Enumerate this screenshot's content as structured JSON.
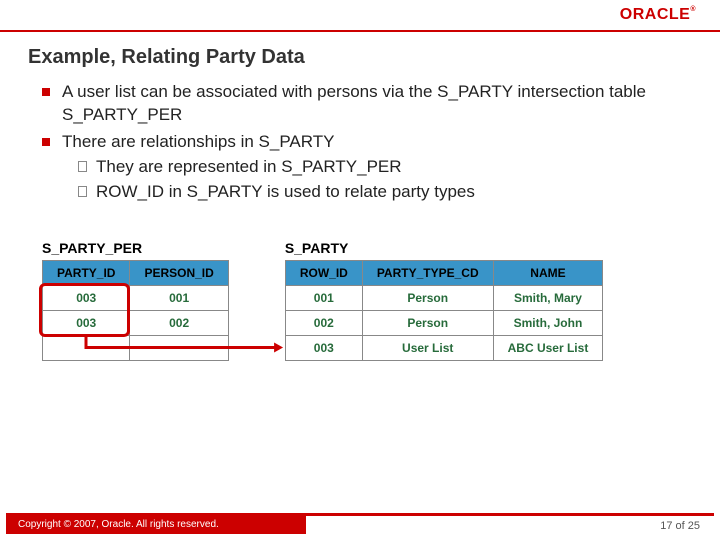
{
  "logo_text": "ORACLE",
  "title": "Example, Relating Party Data",
  "bullets": [
    {
      "text": "A user list can be associated with persons via the S_PARTY intersection table S_PARTY_PER",
      "sub": []
    },
    {
      "text": "There are relationships in S_PARTY",
      "sub": [
        "They are represented in S_PARTY_PER",
        "ROW_ID in S_PARTY is used to relate party types"
      ]
    }
  ],
  "table1": {
    "name": "S_PARTY_PER",
    "headers": [
      "PARTY_ID",
      "PERSON_ID"
    ],
    "rows": [
      [
        "003",
        "001"
      ],
      [
        "003",
        "002"
      ],
      [
        "",
        ""
      ]
    ]
  },
  "table2": {
    "name": "S_PARTY",
    "headers": [
      "ROW_ID",
      "PARTY_TYPE_CD",
      "NAME"
    ],
    "rows": [
      [
        "001",
        "Person",
        "Smith, Mary"
      ],
      [
        "002",
        "Person",
        "Smith, John"
      ],
      [
        "003",
        "User List",
        "ABC User List"
      ]
    ]
  },
  "footer": {
    "copyright": "Copyright © 2007, Oracle. All rights reserved.",
    "page": "17",
    "page_sep": " of ",
    "page_total": "25"
  }
}
